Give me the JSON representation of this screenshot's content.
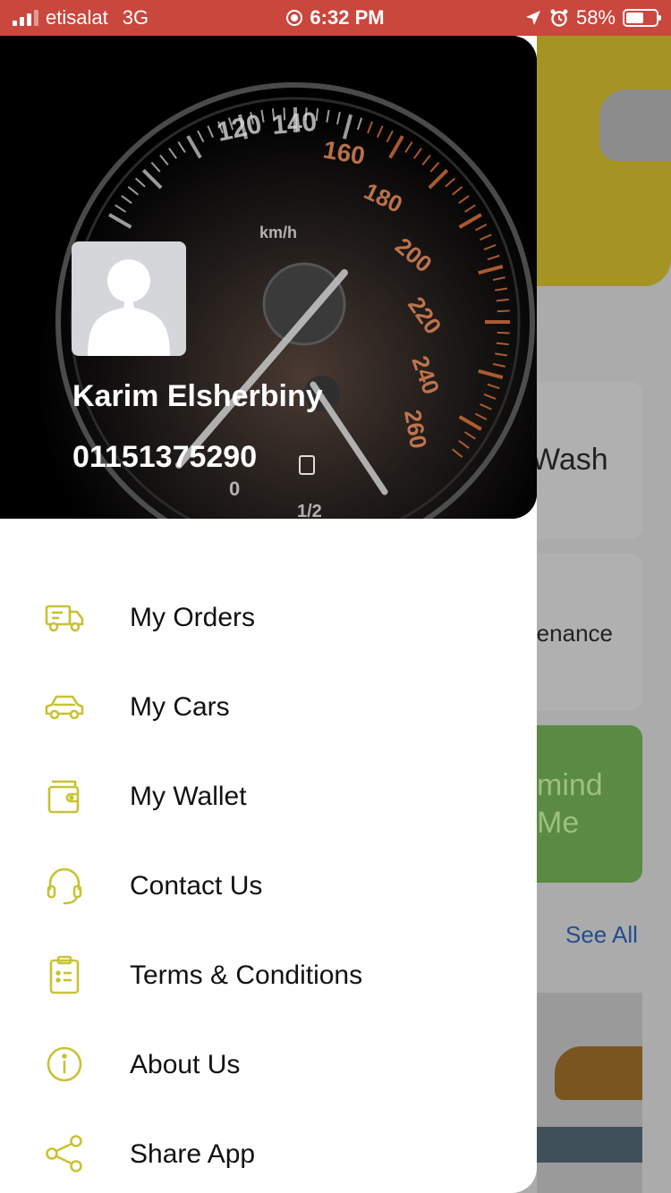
{
  "status_bar": {
    "carrier": "etisalat",
    "network": "3G",
    "time": "6:32 PM",
    "battery": "58%",
    "battery_level": 0.58
  },
  "background": {
    "card_wash": "Wash",
    "card_maintenance": "ntenance",
    "card_remind_line1": "mind",
    "card_remind_line2": "Me",
    "see_all": "See All"
  },
  "drawer": {
    "user": {
      "name": "Karim Elsherbiny",
      "phone": "01151375290"
    },
    "gauge_labels": [
      "120",
      "140",
      "160",
      "180",
      "200",
      "220",
      "240",
      "260",
      "km/h",
      "0",
      "1/2"
    ],
    "menu": [
      {
        "label": "My Orders",
        "icon": "truck-icon"
      },
      {
        "label": "My Cars",
        "icon": "car-icon"
      },
      {
        "label": "My Wallet",
        "icon": "wallet-icon"
      },
      {
        "label": "Contact Us",
        "icon": "headset-icon"
      },
      {
        "label": "Terms & Conditions",
        "icon": "clipboard-icon"
      },
      {
        "label": "About Us",
        "icon": "info-icon"
      },
      {
        "label": "Share App",
        "icon": "share-icon"
      }
    ]
  },
  "colors": {
    "accent": "#c9c233",
    "status_bar": "#c9473d"
  }
}
